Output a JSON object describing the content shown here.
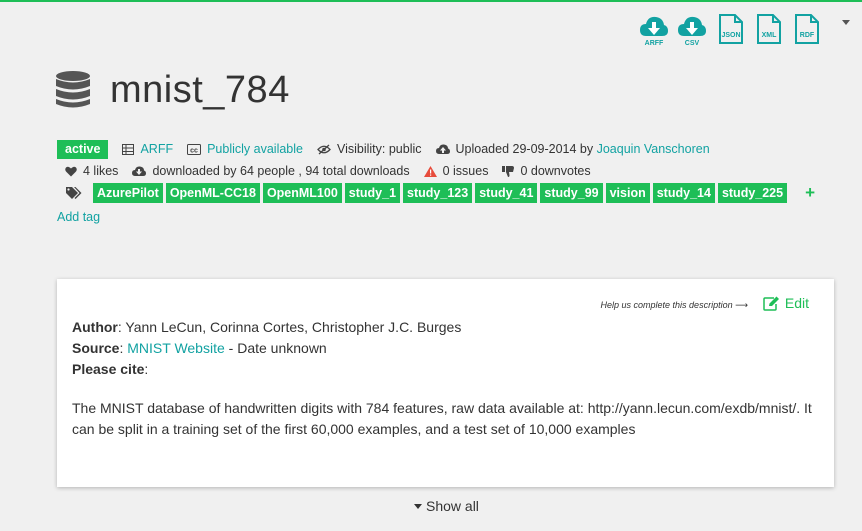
{
  "colors": {
    "accent": "#1ebe57",
    "link": "#12a2a2",
    "warning": "#e74c3c"
  },
  "downloads": [
    {
      "label": "ARFF",
      "icon": "cloud-download-icon"
    },
    {
      "label": "CSV",
      "icon": "cloud-download-icon"
    },
    {
      "label": "JSON",
      "icon": "file-icon"
    },
    {
      "label": "XML",
      "icon": "file-icon"
    },
    {
      "label": "RDF",
      "icon": "file-icon"
    }
  ],
  "dataset": {
    "title": "mnist_784",
    "icon": "database-icon"
  },
  "meta": {
    "status": "active",
    "format": "ARFF",
    "license": "Publicly available",
    "visibility": "Visibility: public",
    "uploaded": "Uploaded 29-09-2014 by",
    "uploader": "Joaquin Vanschoren",
    "likes": "4 likes",
    "downloads": "downloaded by 64 people , 94 total downloads",
    "issues": "0 issues",
    "downvotes": "0 downvotes"
  },
  "tags": [
    "AzurePilot",
    "OpenML-CC18",
    "OpenML100",
    "study_1",
    "study_123",
    "study_41",
    "study_99",
    "vision",
    "study_14",
    "study_225"
  ],
  "add_tag": "Add tag",
  "description": {
    "help_text": "Help us complete this description",
    "edit_label": "Edit",
    "author_label": "Author",
    "author_value": ": Yann LeCun, Corinna Cortes, Christopher J.C. Burges",
    "source_label": "Source",
    "source_link": "MNIST Website",
    "source_rest": " - Date unknown",
    "cite_label": "Please cite",
    "cite_rest": ":",
    "body": "The MNIST database of handwritten digits with 784 features, raw data available at: http://yann.lecun.com/exdb/mnist/. It can be split in a training set of the first 60,000 examples, and a test set of 10,000 examples"
  },
  "show_all": "Show all"
}
